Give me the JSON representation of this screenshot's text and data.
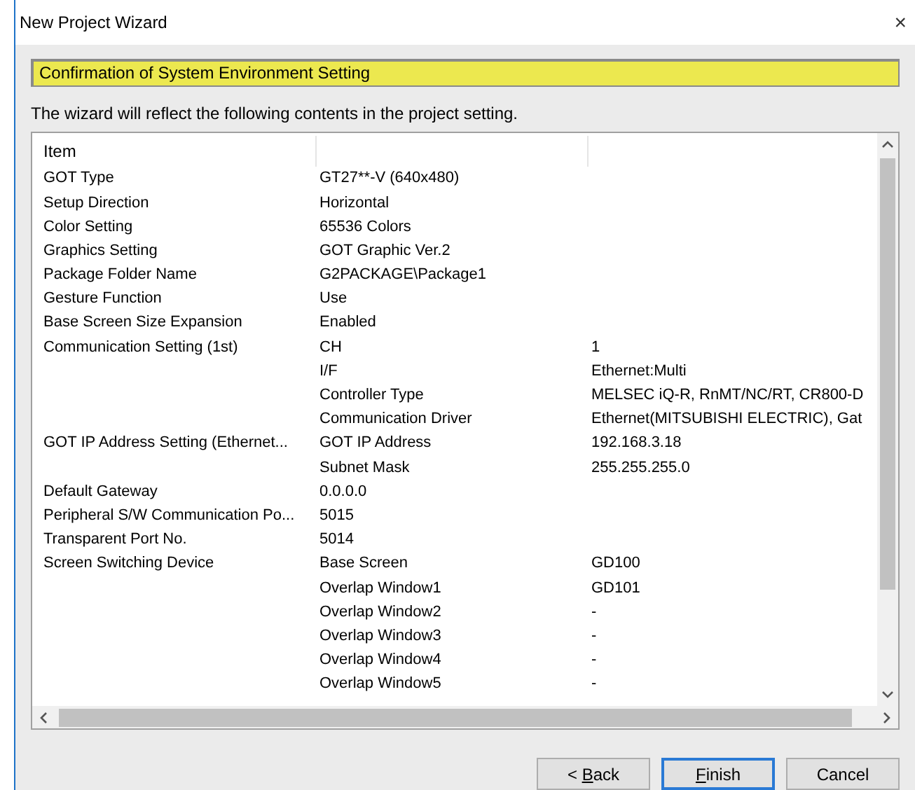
{
  "window": {
    "title": "New Project Wizard",
    "close": "×"
  },
  "step_title": "Confirmation of System Environment Setting",
  "description": "The wizard will reflect the following contents in the project setting.",
  "table": {
    "columns": [
      "Item"
    ],
    "rows": [
      {
        "c1": "GOT Type",
        "c2": "GT27**-V (640x480)"
      },
      {
        "c1": "Setup Direction",
        "c2": "Horizontal"
      },
      {
        "c1": "Color Setting",
        "c2": "65536 Colors"
      },
      {
        "c1": "Graphics Setting",
        "c2": "GOT Graphic Ver.2"
      },
      {
        "c1": "Package Folder Name",
        "c2": "G2PACKAGE\\Package1"
      },
      {
        "c1": "Gesture Function",
        "c2": "Use"
      },
      {
        "c1": "Base Screen Size Expansion",
        "c2": "Enabled"
      },
      {
        "c1": "Communication Setting (1st)",
        "c2": "CH",
        "c3": "1"
      },
      {
        "c2": "I/F",
        "c3": "Ethernet:Multi"
      },
      {
        "c2": "Controller Type",
        "c3": "MELSEC iQ-R, RnMT/NC/RT, CR800-D"
      },
      {
        "c2": "Communication Driver",
        "c3": "Ethernet(MITSUBISHI ELECTRIC), Gat"
      },
      {
        "c1": "GOT IP Address Setting (Ethernet...",
        "c2": "GOT IP Address",
        "c3": "192.168.3.18"
      },
      {
        "c2": "Subnet Mask",
        "c3": "255.255.255.0"
      },
      {
        "c1": "Default Gateway",
        "c2": "0.0.0.0"
      },
      {
        "c1": "Peripheral S/W Communication Po...",
        "c2": "5015"
      },
      {
        "c1": "Transparent Port No.",
        "c2": "5014"
      },
      {
        "c1": "Screen Switching Device",
        "c2": "Base Screen",
        "c3": "GD100"
      },
      {
        "c2": "Overlap Window1",
        "c3": "GD101"
      },
      {
        "c2": "Overlap Window2",
        "c3": "-"
      },
      {
        "c2": "Overlap Window3",
        "c3": "-"
      },
      {
        "c2": "Overlap Window4",
        "c3": "-"
      },
      {
        "c2": "Overlap Window5",
        "c3": "-"
      }
    ]
  },
  "buttons": [
    {
      "prefix": "< ",
      "key": "B",
      "rest": "ack",
      "default": false
    },
    {
      "key": "F",
      "rest": "inish",
      "default": true
    },
    {
      "rest": "Cancel",
      "default": false
    }
  ]
}
